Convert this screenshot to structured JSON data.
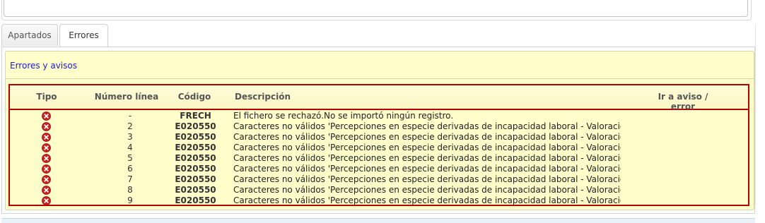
{
  "tabs": [
    {
      "label": "Apartados",
      "active": false
    },
    {
      "label": "Errores",
      "active": true
    }
  ],
  "panel": {
    "title": "Errores y avisos",
    "columns": {
      "tipo": "Tipo",
      "numero_linea": "Número línea",
      "codigo": "Código",
      "descripcion": "Descripción",
      "ir": "Ir a aviso / error"
    },
    "rows": [
      {
        "type": "error-icon",
        "line": "-",
        "code": "FRECH",
        "description": "El fichero se rechazó.No se importó ningún registro."
      },
      {
        "type": "error-icon",
        "line": "2",
        "code": "E020550",
        "description": "Caracteres no válidos 'Percepciones en especie derivadas de incapacidad laboral - Valoración'"
      },
      {
        "type": "error-icon",
        "line": "3",
        "code": "E020550",
        "description": "Caracteres no válidos 'Percepciones en especie derivadas de incapacidad laboral - Valoración'"
      },
      {
        "type": "error-icon",
        "line": "4",
        "code": "E020550",
        "description": "Caracteres no válidos 'Percepciones en especie derivadas de incapacidad laboral - Valoración'"
      },
      {
        "type": "error-icon",
        "line": "5",
        "code": "E020550",
        "description": "Caracteres no válidos 'Percepciones en especie derivadas de incapacidad laboral - Valoración'"
      },
      {
        "type": "error-icon",
        "line": "6",
        "code": "E020550",
        "description": "Caracteres no válidos 'Percepciones en especie derivadas de incapacidad laboral - Valoración'"
      },
      {
        "type": "error-icon",
        "line": "7",
        "code": "E020550",
        "description": "Caracteres no válidos 'Percepciones en especie derivadas de incapacidad laboral - Valoración'"
      },
      {
        "type": "error-icon",
        "line": "8",
        "code": "E020550",
        "description": "Caracteres no válidos 'Percepciones en especie derivadas de incapacidad laboral - Valoración'"
      },
      {
        "type": "error-icon",
        "line": "9",
        "code": "E020550",
        "description": "Caracteres no válidos 'Percepciones en especie derivadas de incapacidad laboral - Valoración'"
      }
    ]
  },
  "colors": {
    "panel_bg": "#fffdca",
    "table_border": "#b80000",
    "title_link": "#1a1ad6",
    "error_icon": "#cc1f1f"
  }
}
